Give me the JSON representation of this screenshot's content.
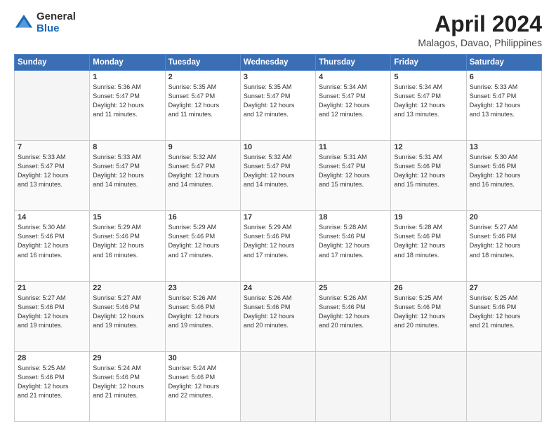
{
  "logo": {
    "general": "General",
    "blue": "Blue"
  },
  "header": {
    "title": "April 2024",
    "subtitle": "Malagos, Davao, Philippines"
  },
  "days_of_week": [
    "Sunday",
    "Monday",
    "Tuesday",
    "Wednesday",
    "Thursday",
    "Friday",
    "Saturday"
  ],
  "weeks": [
    [
      {
        "day": "",
        "info": ""
      },
      {
        "day": "1",
        "info": "Sunrise: 5:36 AM\nSunset: 5:47 PM\nDaylight: 12 hours\nand 11 minutes."
      },
      {
        "day": "2",
        "info": "Sunrise: 5:35 AM\nSunset: 5:47 PM\nDaylight: 12 hours\nand 11 minutes."
      },
      {
        "day": "3",
        "info": "Sunrise: 5:35 AM\nSunset: 5:47 PM\nDaylight: 12 hours\nand 12 minutes."
      },
      {
        "day": "4",
        "info": "Sunrise: 5:34 AM\nSunset: 5:47 PM\nDaylight: 12 hours\nand 12 minutes."
      },
      {
        "day": "5",
        "info": "Sunrise: 5:34 AM\nSunset: 5:47 PM\nDaylight: 12 hours\nand 13 minutes."
      },
      {
        "day": "6",
        "info": "Sunrise: 5:33 AM\nSunset: 5:47 PM\nDaylight: 12 hours\nand 13 minutes."
      }
    ],
    [
      {
        "day": "7",
        "info": "Sunrise: 5:33 AM\nSunset: 5:47 PM\nDaylight: 12 hours\nand 13 minutes."
      },
      {
        "day": "8",
        "info": "Sunrise: 5:33 AM\nSunset: 5:47 PM\nDaylight: 12 hours\nand 14 minutes."
      },
      {
        "day": "9",
        "info": "Sunrise: 5:32 AM\nSunset: 5:47 PM\nDaylight: 12 hours\nand 14 minutes."
      },
      {
        "day": "10",
        "info": "Sunrise: 5:32 AM\nSunset: 5:47 PM\nDaylight: 12 hours\nand 14 minutes."
      },
      {
        "day": "11",
        "info": "Sunrise: 5:31 AM\nSunset: 5:47 PM\nDaylight: 12 hours\nand 15 minutes."
      },
      {
        "day": "12",
        "info": "Sunrise: 5:31 AM\nSunset: 5:46 PM\nDaylight: 12 hours\nand 15 minutes."
      },
      {
        "day": "13",
        "info": "Sunrise: 5:30 AM\nSunset: 5:46 PM\nDaylight: 12 hours\nand 16 minutes."
      }
    ],
    [
      {
        "day": "14",
        "info": "Sunrise: 5:30 AM\nSunset: 5:46 PM\nDaylight: 12 hours\nand 16 minutes."
      },
      {
        "day": "15",
        "info": "Sunrise: 5:29 AM\nSunset: 5:46 PM\nDaylight: 12 hours\nand 16 minutes."
      },
      {
        "day": "16",
        "info": "Sunrise: 5:29 AM\nSunset: 5:46 PM\nDaylight: 12 hours\nand 17 minutes."
      },
      {
        "day": "17",
        "info": "Sunrise: 5:29 AM\nSunset: 5:46 PM\nDaylight: 12 hours\nand 17 minutes."
      },
      {
        "day": "18",
        "info": "Sunrise: 5:28 AM\nSunset: 5:46 PM\nDaylight: 12 hours\nand 17 minutes."
      },
      {
        "day": "19",
        "info": "Sunrise: 5:28 AM\nSunset: 5:46 PM\nDaylight: 12 hours\nand 18 minutes."
      },
      {
        "day": "20",
        "info": "Sunrise: 5:27 AM\nSunset: 5:46 PM\nDaylight: 12 hours\nand 18 minutes."
      }
    ],
    [
      {
        "day": "21",
        "info": "Sunrise: 5:27 AM\nSunset: 5:46 PM\nDaylight: 12 hours\nand 19 minutes."
      },
      {
        "day": "22",
        "info": "Sunrise: 5:27 AM\nSunset: 5:46 PM\nDaylight: 12 hours\nand 19 minutes."
      },
      {
        "day": "23",
        "info": "Sunrise: 5:26 AM\nSunset: 5:46 PM\nDaylight: 12 hours\nand 19 minutes."
      },
      {
        "day": "24",
        "info": "Sunrise: 5:26 AM\nSunset: 5:46 PM\nDaylight: 12 hours\nand 20 minutes."
      },
      {
        "day": "25",
        "info": "Sunrise: 5:26 AM\nSunset: 5:46 PM\nDaylight: 12 hours\nand 20 minutes."
      },
      {
        "day": "26",
        "info": "Sunrise: 5:25 AM\nSunset: 5:46 PM\nDaylight: 12 hours\nand 20 minutes."
      },
      {
        "day": "27",
        "info": "Sunrise: 5:25 AM\nSunset: 5:46 PM\nDaylight: 12 hours\nand 21 minutes."
      }
    ],
    [
      {
        "day": "28",
        "info": "Sunrise: 5:25 AM\nSunset: 5:46 PM\nDaylight: 12 hours\nand 21 minutes."
      },
      {
        "day": "29",
        "info": "Sunrise: 5:24 AM\nSunset: 5:46 PM\nDaylight: 12 hours\nand 21 minutes."
      },
      {
        "day": "30",
        "info": "Sunrise: 5:24 AM\nSunset: 5:46 PM\nDaylight: 12 hours\nand 22 minutes."
      },
      {
        "day": "",
        "info": ""
      },
      {
        "day": "",
        "info": ""
      },
      {
        "day": "",
        "info": ""
      },
      {
        "day": "",
        "info": ""
      }
    ]
  ]
}
